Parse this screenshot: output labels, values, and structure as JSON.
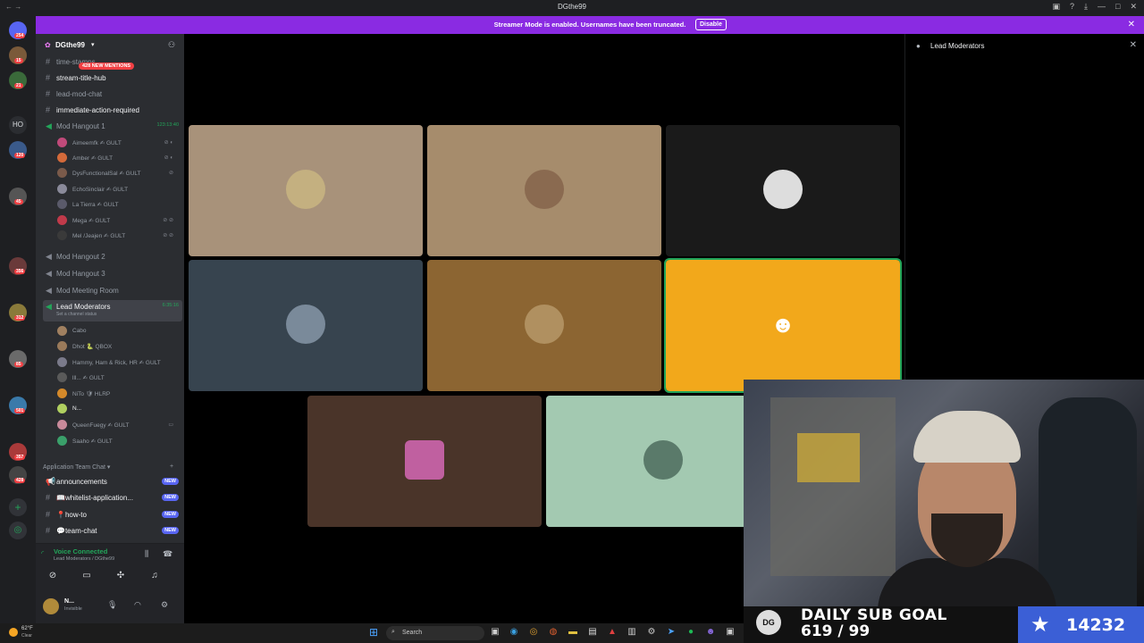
{
  "window": {
    "title": "DGthe99",
    "nav": "←  →"
  },
  "banner": {
    "text": "Streamer Mode is enabled. Usernames have been truncated.",
    "disable_label": "Disable"
  },
  "server_rail": {
    "badges": [
      "254",
      "15",
      "21",
      "HO",
      "120",
      "45",
      "356",
      "312",
      "85",
      "501",
      "357",
      "428"
    ]
  },
  "guild": {
    "name": "DGthe99",
    "mentions_badge": "428 NEW MENTIONS",
    "channels": [
      {
        "label": "time-stamps"
      },
      {
        "label": "stream-title-hub"
      },
      {
        "label": "lead-mod-chat"
      },
      {
        "label": "immediate-action-required"
      }
    ],
    "voice_channels": {
      "hangout1": {
        "label": "Mod Hangout 1",
        "timer": "123:13:40"
      },
      "hangout2": "Mod Hangout 2",
      "hangout3": "Mod Hangout 3",
      "meeting": "Mod Meeting Room",
      "lead": {
        "label": "Lead Moderators",
        "timer": "6:35:16",
        "status": "Set a channel status"
      }
    },
    "hangout_members": [
      {
        "name": "Aimeemfk",
        "tag": "GULT"
      },
      {
        "name": "Amber",
        "tag": "GULT"
      },
      {
        "name": "DysFunctionalSal",
        "tag": "GULT"
      },
      {
        "name": "EchoSinclair",
        "tag": "GULT"
      },
      {
        "name": "La Tierra",
        "tag": "GULT"
      },
      {
        "name": "Mega",
        "tag": "GULT"
      },
      {
        "name": "Mel /Jeajen",
        "tag": "GULT"
      }
    ],
    "lead_members": [
      {
        "name": "Cabo",
        "tag": ""
      },
      {
        "name": "Dhot",
        "tag": "QBOX"
      },
      {
        "name": "Hammy, Ham & Rick, HR",
        "tag": "GULT"
      },
      {
        "name": "lll...",
        "tag": "GULT"
      },
      {
        "name": "NiTo",
        "tag": "HLRP"
      },
      {
        "name": "N...",
        "tag": ""
      },
      {
        "name": "QueenFuegy",
        "tag": "GULT"
      },
      {
        "name": "Saaho",
        "tag": "GULT"
      }
    ],
    "category": "Application Team Chat",
    "app_channels": [
      {
        "label": "announcements",
        "badge": "NEW"
      },
      {
        "label": "📖whitelist-application...",
        "badge": "NEW"
      },
      {
        "label": "📍how-to",
        "badge": "NEW"
      },
      {
        "label": "💬team-chat",
        "badge": "NEW"
      }
    ]
  },
  "voice_panel": {
    "status": "Voice Connected",
    "location": "Lead Moderators / DGthe99"
  },
  "user_panel": {
    "name": "N...",
    "status": "Invisible"
  },
  "right_panel": {
    "title": "Lead Moderators"
  },
  "tiles": {
    "colors": [
      "#a8927a",
      "#a68c6c",
      "#1a1a1a",
      "#37444f",
      "#8c6532",
      "#f2a81b",
      "#4a3429",
      "#a3c9b1"
    ]
  },
  "goal": {
    "logo": "DG",
    "title": "DAILY SUB GOAL",
    "progress": "619 / 99",
    "count": "14232"
  },
  "taskbar": {
    "temp": "62°F",
    "weather": "Clear",
    "search": "Search"
  }
}
